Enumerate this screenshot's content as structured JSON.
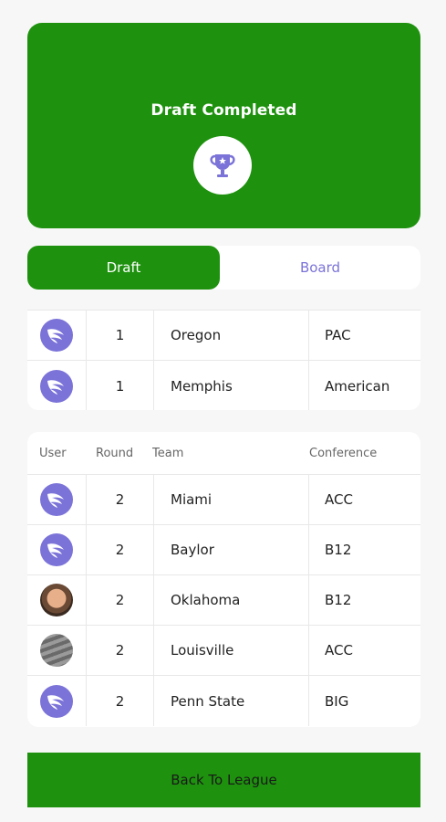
{
  "banner": {
    "title": "Draft Completed",
    "icon": "trophy-icon"
  },
  "tabs": [
    {
      "label": "Draft",
      "active": true
    },
    {
      "label": "Board",
      "active": false
    }
  ],
  "colors": {
    "accent": "#1e920e",
    "tab_inactive_text": "#7b73d8",
    "logo_bg": "#7b73d8"
  },
  "previous_picks": [
    {
      "avatar": "wing-logo-icon",
      "round": "1",
      "team": "Oregon",
      "conference": "PAC"
    },
    {
      "avatar": "wing-logo-icon",
      "round": "1",
      "team": "Memphis",
      "conference": "American"
    }
  ],
  "table": {
    "headers": {
      "user": "User",
      "round": "Round",
      "team": "Team",
      "conference": "Conference"
    },
    "rows": [
      {
        "avatar": "wing-logo-icon",
        "round": "2",
        "team": "Miami",
        "conference": "ACC"
      },
      {
        "avatar": "wing-logo-icon",
        "round": "2",
        "team": "Baylor",
        "conference": "B12"
      },
      {
        "avatar": "user-photo",
        "round": "2",
        "team": "Oklahoma",
        "conference": "B12"
      },
      {
        "avatar": "user-photo",
        "round": "2",
        "team": "Louisville",
        "conference": "ACC"
      },
      {
        "avatar": "wing-logo-icon",
        "round": "2",
        "team": "Penn State",
        "conference": "BIG"
      }
    ]
  },
  "footer": {
    "back_label": "Back To League"
  }
}
